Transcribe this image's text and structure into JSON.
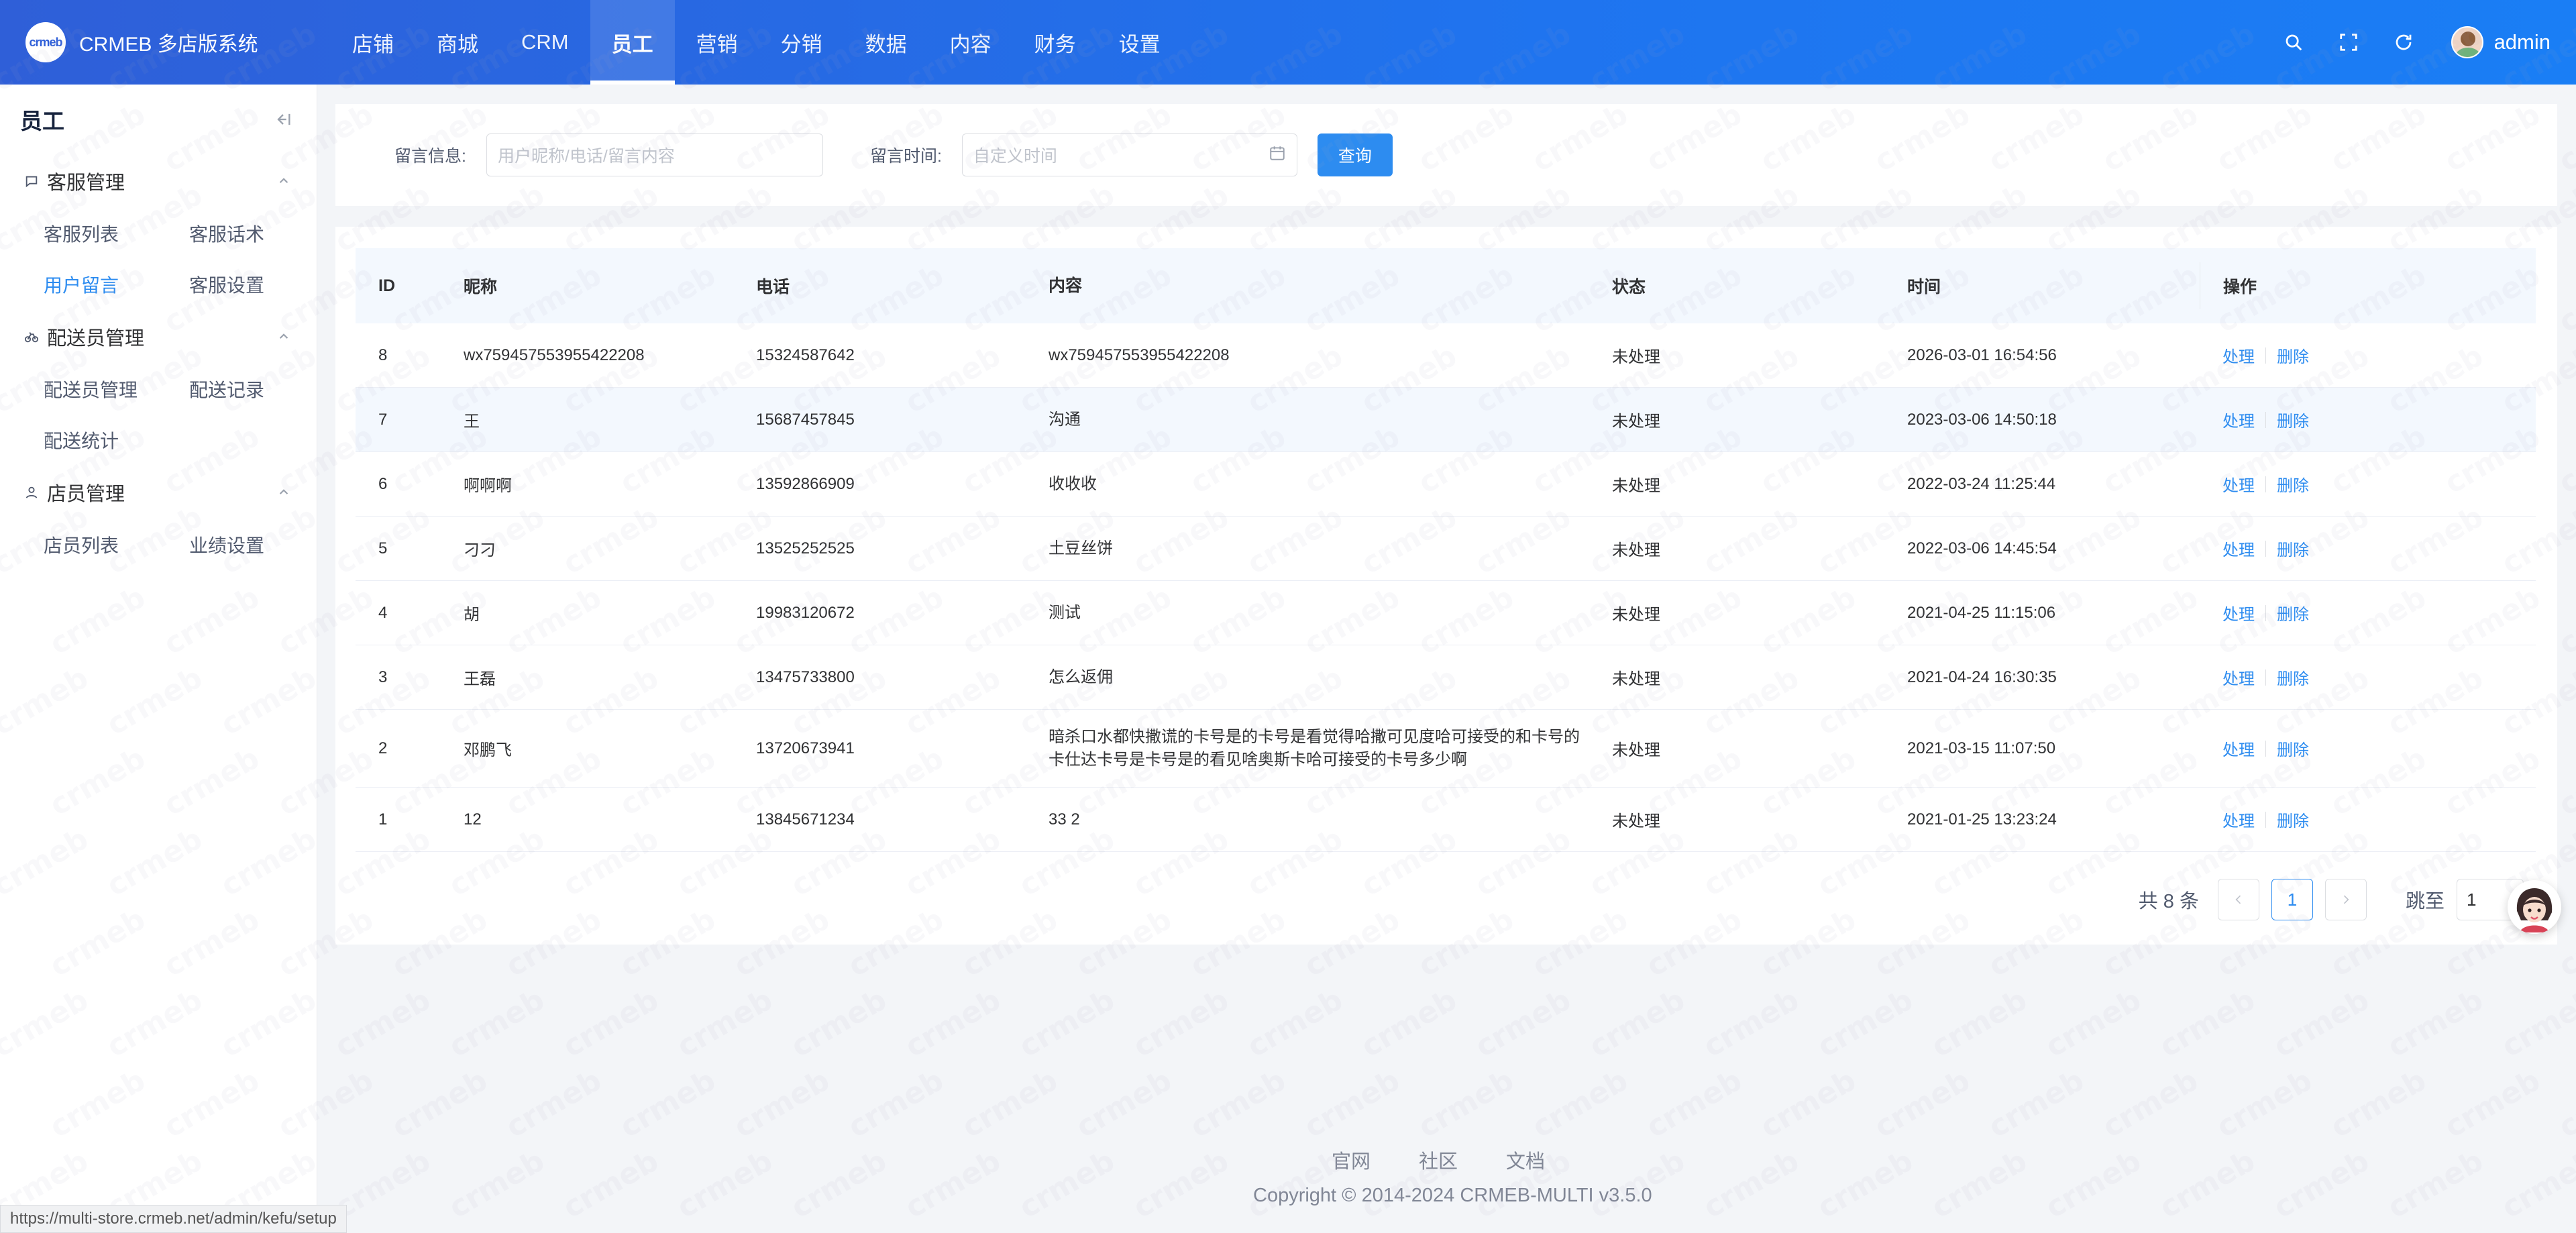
{
  "header": {
    "logo_text": "crmeb",
    "brand": "CRMEB 多店版系统",
    "nav": [
      "店铺",
      "商城",
      "CRM",
      "员工",
      "营销",
      "分销",
      "数据",
      "内容",
      "财务",
      "设置"
    ],
    "active_nav": "员工",
    "username": "admin"
  },
  "sidebar": {
    "title": "员工",
    "groups": [
      {
        "label": "客服管理",
        "icon": "chat-icon",
        "items": [
          "客服列表",
          "客服话术",
          "用户留言",
          "客服设置"
        ]
      },
      {
        "label": "配送员管理",
        "icon": "bike-icon",
        "items": [
          "配送员管理",
          "配送记录",
          "配送统计"
        ]
      },
      {
        "label": "店员管理",
        "icon": "person-icon",
        "items": [
          "店员列表",
          "业绩设置"
        ]
      }
    ],
    "active_item": "用户留言"
  },
  "filter": {
    "msg_label": "留言信息:",
    "msg_placeholder": "用户昵称/电话/留言内容",
    "time_label": "留言时间:",
    "time_placeholder": "自定义时间",
    "query_button": "查询"
  },
  "table": {
    "columns": [
      "ID",
      "昵称",
      "电话",
      "内容",
      "状态",
      "时间",
      "操作"
    ],
    "rows": [
      {
        "id": "8",
        "nick": "wx759457553955422208",
        "tel": "15324587642",
        "content": "wx759457553955422208",
        "status": "未处理",
        "time": "2026-03-01 16:54:56"
      },
      {
        "id": "7",
        "nick": "王",
        "tel": "15687457845",
        "content": "沟通",
        "status": "未处理",
        "time": "2023-03-06 14:50:18"
      },
      {
        "id": "6",
        "nick": "啊啊啊",
        "tel": "13592866909",
        "content": "收收收",
        "status": "未处理",
        "time": "2022-03-24 11:25:44"
      },
      {
        "id": "5",
        "nick": "刁刁",
        "tel": "13525252525",
        "content": "土豆丝饼",
        "status": "未处理",
        "time": "2022-03-06 14:45:54"
      },
      {
        "id": "4",
        "nick": "胡",
        "tel": "19983120672",
        "content": "测试",
        "status": "未处理",
        "time": "2021-04-25 11:15:06"
      },
      {
        "id": "3",
        "nick": "王磊",
        "tel": "13475733800",
        "content": "怎么返佣",
        "status": "未处理",
        "time": "2021-04-24 16:30:35"
      },
      {
        "id": "2",
        "nick": "邓鹏飞",
        "tel": "13720673941",
        "content": "暗杀口水都快撒谎的卡号是的卡号是看觉得哈撒可见度哈可接受的和卡号的卡仕达卡号是卡号是的看见啥奥斯卡哈可接受的卡号多少啊",
        "status": "未处理",
        "time": "2021-03-15 11:07:50"
      },
      {
        "id": "1",
        "nick": "12",
        "tel": "13845671234",
        "content": "33 2",
        "status": "未处理",
        "time": "2021-01-25 13:23:24"
      }
    ],
    "op_process": "处理",
    "op_delete": "删除"
  },
  "pagination": {
    "total_text": "共 8 条",
    "current_page": "1",
    "jump_label": "跳至",
    "jump_value": "1"
  },
  "footer": {
    "links": [
      "官网",
      "社区",
      "文档"
    ],
    "copyright": "Copyright © 2014-2024 CRMEB-MULTI v3.5.0"
  },
  "status_bar": {
    "url": "https://multi-store.crmeb.net/admin/kefu/setup"
  },
  "colors": {
    "primary": "#2d8cf0",
    "header_start": "#2f5fd8",
    "header_end": "#1a7ef5"
  }
}
